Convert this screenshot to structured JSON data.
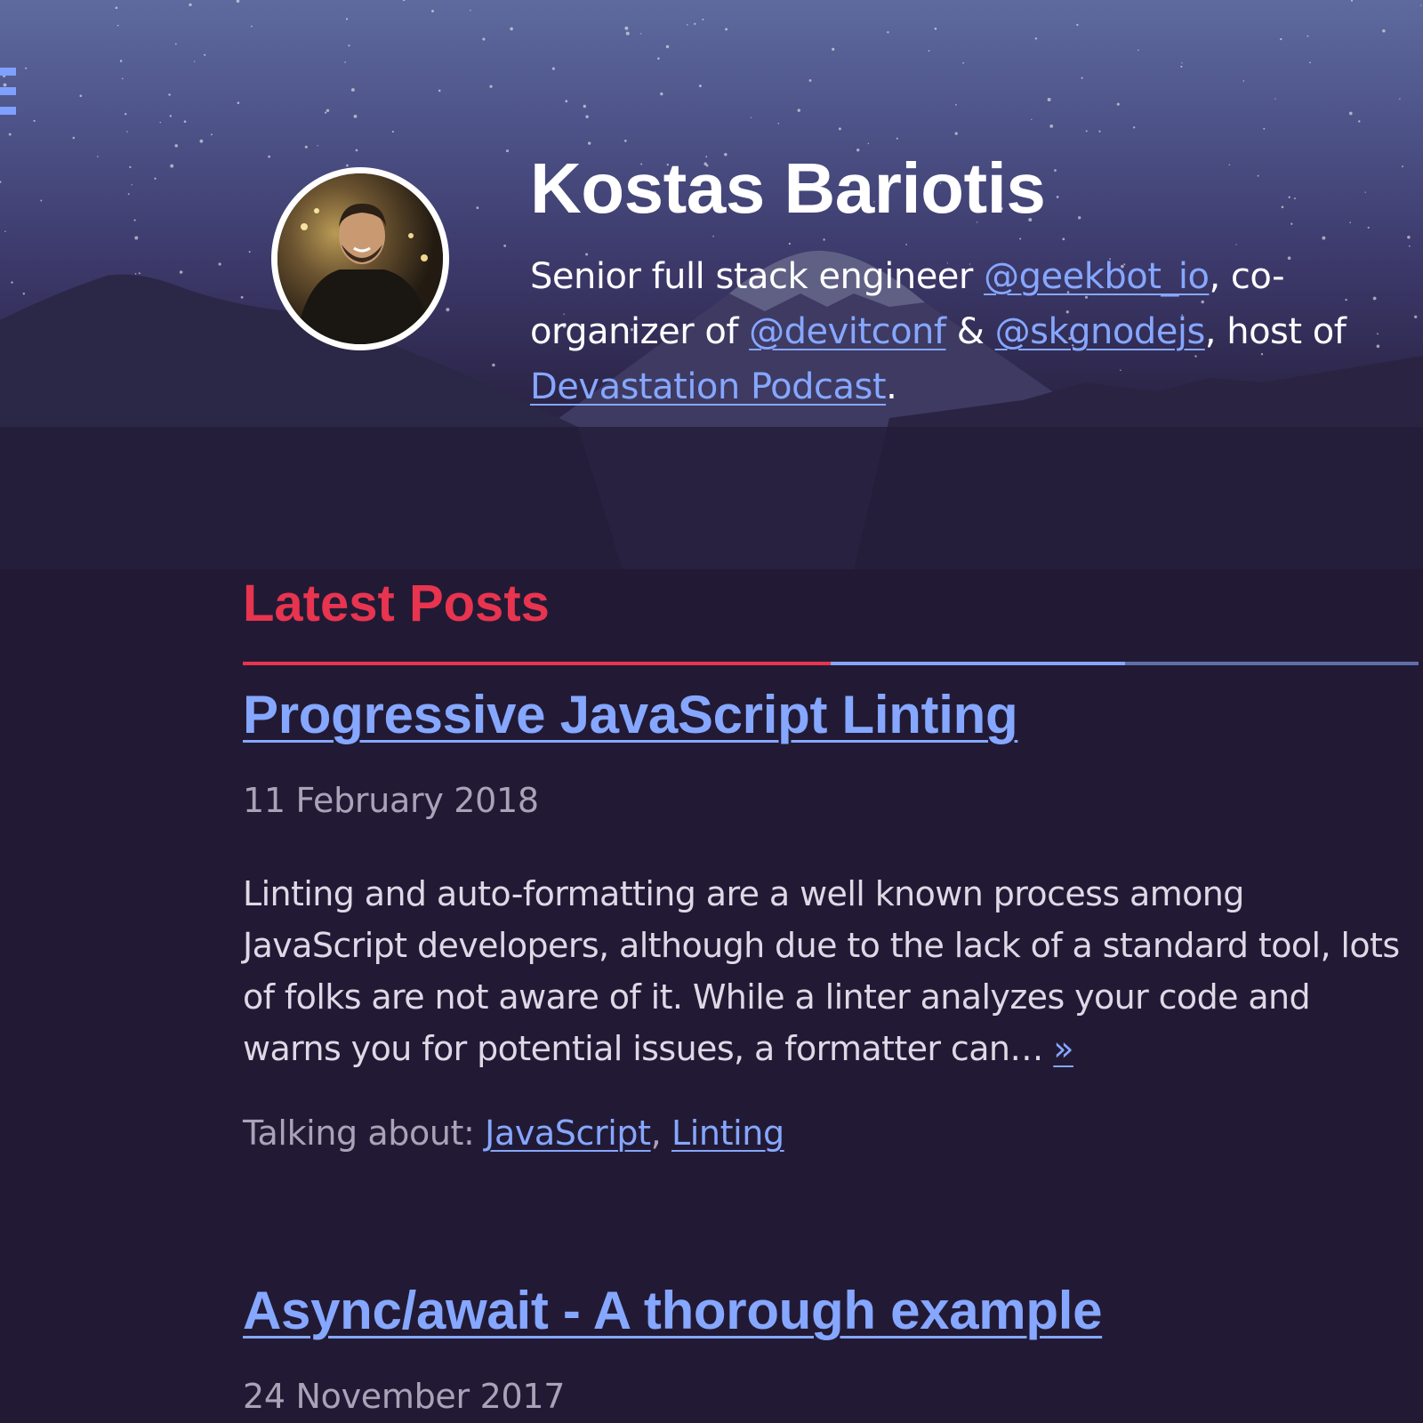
{
  "header": {
    "name": "Kostas Bariotis",
    "bio_prefix": "Senior full stack engineer ",
    "link_geekbot": "@geekbot_io",
    "bio_mid1": ", co-organizer of ",
    "link_devitconf": "@devitconf",
    "bio_amp": " & ",
    "link_skgnodejs": "@skgnodejs",
    "bio_mid2": ", host of ",
    "link_podcast": "Devastation Podcast",
    "bio_end": "."
  },
  "menu": {
    "icon": "hamburger-icon"
  },
  "latest_posts": {
    "title": "Latest Posts",
    "divider_colors": [
      "#e8344f",
      "#e8344f",
      "#86a7ff",
      "#5f6fa8"
    ]
  },
  "posts": [
    {
      "title": "Progressive JavaScript Linting",
      "date": "11 February 2018",
      "excerpt": "Linting and auto-formatting are a well known process among JavaScript developers, although due to the lack of a standard tool, lots of folks are not aware of it. While a linter analyzes your code and warns you for potential issues, a formatter can… ",
      "read_more": "»",
      "tags_label": "Talking about: ",
      "tags": [
        "JavaScript",
        "Linting"
      ],
      "tag_sep": ", "
    },
    {
      "title": "Async/await - A thorough example",
      "date": "24 November 2017"
    }
  ],
  "colors": {
    "background": "#221a35",
    "link": "#86a7ff",
    "accent": "#e8344f",
    "text": "#ffffff",
    "muted": "#a9a3b8"
  }
}
